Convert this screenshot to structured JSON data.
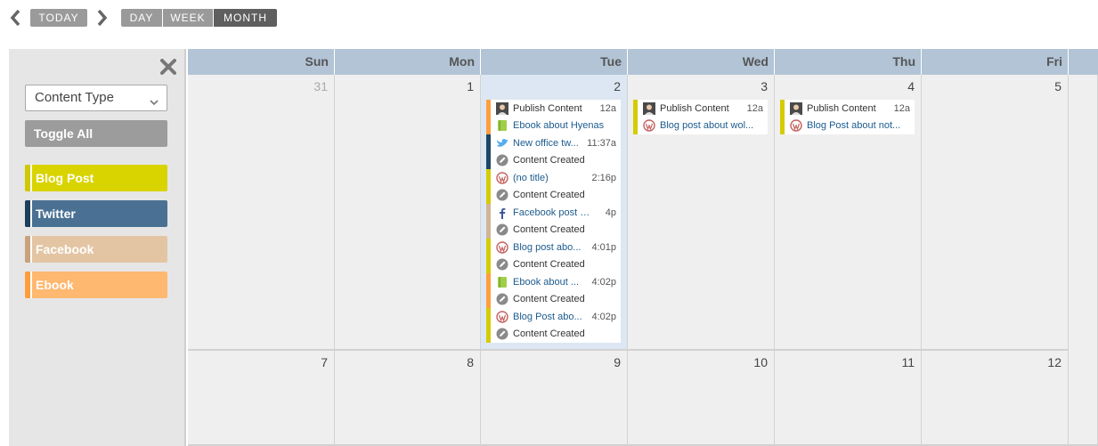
{
  "toolbar": {
    "today": "TODAY",
    "views": {
      "day": "DAY",
      "week": "WEEK",
      "month": "MONTH"
    }
  },
  "sidebar": {
    "select_value": "Content Type",
    "toggle_label": "Toggle All",
    "filters": [
      {
        "label": "Blog Post",
        "color": "#d9d400",
        "stripe": "#cfc900"
      },
      {
        "label": "Twitter",
        "color": "#4a7193",
        "stripe": "#1d3f5f"
      },
      {
        "label": "Facebook",
        "color": "#e3c5a4",
        "stripe": "#c9a27c"
      },
      {
        "label": "Ebook",
        "color": "#ffb870",
        "stripe": "#ff9e3d"
      }
    ]
  },
  "calendar": {
    "days": [
      "Sun",
      "Mon",
      "Tue",
      "Wed",
      "Thu",
      "Fri"
    ],
    "week1": [
      "31",
      "1",
      "2",
      "3",
      "4",
      "5"
    ],
    "week2": [
      "7",
      "8",
      "9",
      "10",
      "11",
      "12"
    ],
    "colors": {
      "blog": "#d4cc00",
      "twitter": "#1d4566",
      "facebook": "#d2b596",
      "ebook": "#ff9e3d",
      "today_bg": "#dce7f3"
    },
    "tue_events": [
      {
        "line1": "Publish Content",
        "time": "12a",
        "line2": "Ebook about Hyenas",
        "icon1": "avatar-icon",
        "icon2": "book-icon"
      },
      {
        "line1": "New office tw...",
        "time": "11:37a",
        "line2": "Content Created",
        "icon1": "twitter-bird-icon",
        "icon2": "pencil-icon"
      },
      {
        "line1": "(no title)",
        "time": "2:16p",
        "line2": "Content Created",
        "icon1": "wordpress-icon",
        "icon2": "pencil-icon"
      },
      {
        "line1": "Facebook post of ...",
        "time": "4p",
        "line2": "Content Created",
        "icon1": "facebook-icon",
        "icon2": "pencil-icon"
      },
      {
        "line1": "Blog post abo...",
        "time": "4:01p",
        "line2": "Content Created",
        "icon1": "wordpress-icon",
        "icon2": "pencil-icon"
      },
      {
        "line1": "Ebook about ...",
        "time": "4:02p",
        "line2": "Content Created",
        "icon1": "book-icon",
        "icon2": "pencil-icon"
      },
      {
        "line1": "Blog Post abo...",
        "time": "4:02p",
        "line2": "Content Created",
        "icon1": "wordpress-icon",
        "icon2": "pencil-icon"
      }
    ],
    "wed_event": {
      "line1": "Publish Content",
      "time": "12a",
      "line2": "Blog post about wol...",
      "icon1": "avatar-icon",
      "icon2": "wordpress-icon"
    },
    "thu_event": {
      "line1": "Publish Content",
      "time": "12a",
      "line2": "Blog Post about not...",
      "icon1": "avatar-icon",
      "icon2": "wordpress-icon"
    }
  }
}
